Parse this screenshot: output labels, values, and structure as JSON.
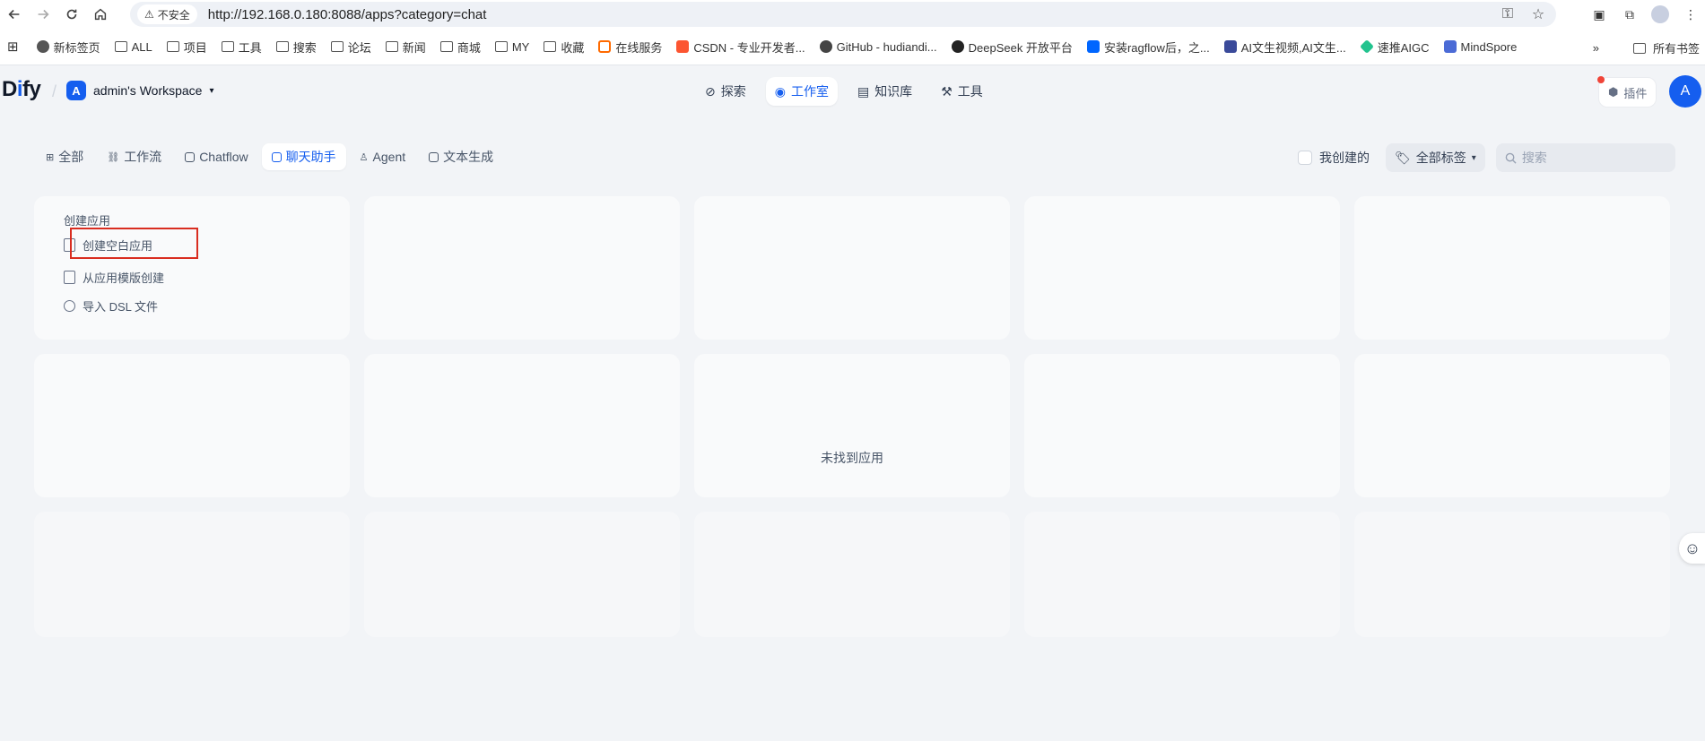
{
  "browser": {
    "security_label": "不安全",
    "url": "http://192.168.0.180:8088/apps?category=chat"
  },
  "bookmarks": {
    "items": [
      {
        "label": "新标签页",
        "icon": "globe-icon"
      },
      {
        "label": "ALL",
        "icon": "folder-icon"
      },
      {
        "label": "项目",
        "icon": "folder-icon"
      },
      {
        "label": "工具",
        "icon": "folder-icon"
      },
      {
        "label": "搜索",
        "icon": "folder-icon"
      },
      {
        "label": "论坛",
        "icon": "folder-icon"
      },
      {
        "label": "新闻",
        "icon": "folder-icon"
      },
      {
        "label": "商城",
        "icon": "folder-icon"
      },
      {
        "label": "MY",
        "icon": "folder-icon"
      },
      {
        "label": "收藏",
        "icon": "folder-icon"
      },
      {
        "label": "在线服务",
        "icon": "aliyun-icon"
      },
      {
        "label": "CSDN - 专业开发者...",
        "icon": "csdn-icon"
      },
      {
        "label": "GitHub - hudiandi...",
        "icon": "github-icon"
      },
      {
        "label": "DeepSeek 开放平台",
        "icon": "deepseek-icon"
      },
      {
        "label": "安装ragflow后，之...",
        "icon": "zhihu-icon"
      },
      {
        "label": "AI文生视频,AI文生...",
        "icon": "cube-icon"
      },
      {
        "label": "速推AIGC",
        "icon": "diamond-icon"
      },
      {
        "label": "MindSpore",
        "icon": "mindspore-icon"
      }
    ],
    "more_label": "»",
    "all_bookmarks_label": "所有书签"
  },
  "header": {
    "logo_prefix": "D",
    "logo_i": "i",
    "logo_suffix": "fy",
    "workspace_initial": "A",
    "workspace_name": "admin's Workspace",
    "nav": [
      {
        "label": "探索",
        "icon": "compass-icon"
      },
      {
        "label": "工作室",
        "icon": "robot-icon"
      },
      {
        "label": "知识库",
        "icon": "book-icon"
      },
      {
        "label": "工具",
        "icon": "hammer-icon"
      }
    ],
    "plugin_label": "插件",
    "user_initial": "A"
  },
  "toolbar": {
    "tabs": [
      {
        "label": "全部",
        "icon": "grid-icon"
      },
      {
        "label": "工作流",
        "icon": "workflow-icon"
      },
      {
        "label": "Chatflow",
        "icon": "chatflow-icon"
      },
      {
        "label": "聊天助手",
        "icon": "chat-icon"
      },
      {
        "label": "Agent",
        "icon": "agent-icon"
      },
      {
        "label": "文本生成",
        "icon": "text-icon"
      }
    ],
    "my_created_label": "我创建的",
    "tag_filter_label": "全部标签",
    "search_placeholder": "搜索"
  },
  "create_card": {
    "title": "创建应用",
    "items": [
      {
        "label": "创建空白应用",
        "icon": "blank-app-icon"
      },
      {
        "label": "从应用模版创建",
        "icon": "template-icon"
      },
      {
        "label": "导入 DSL 文件",
        "icon": "import-icon"
      }
    ]
  },
  "empty_state": {
    "text": "未找到应用"
  },
  "colors": {
    "accent": "#155eef",
    "highlight": "#d92d20",
    "background": "#f2f4f7"
  }
}
